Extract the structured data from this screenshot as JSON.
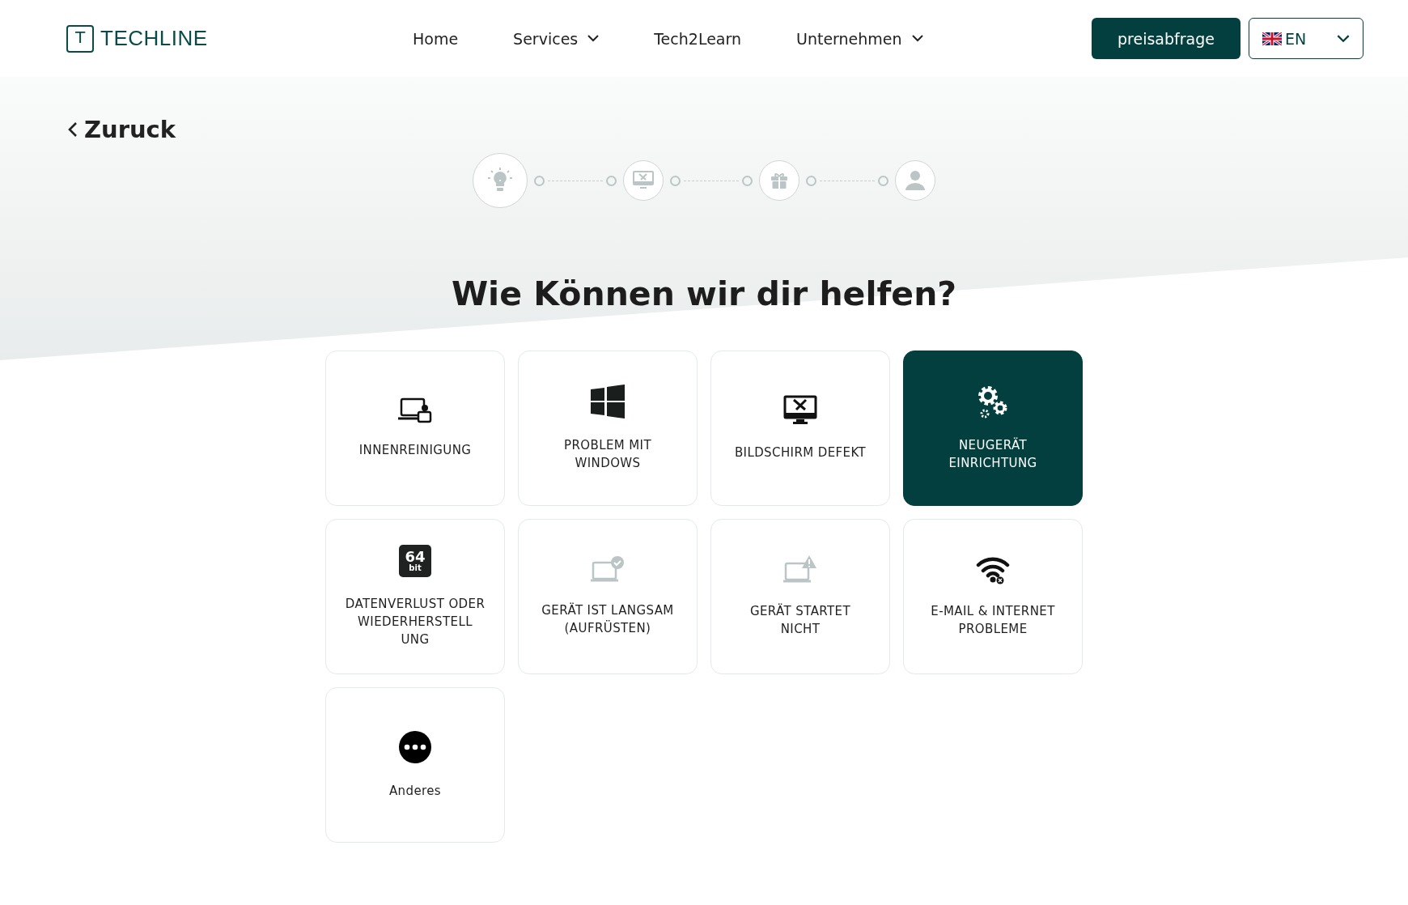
{
  "header": {
    "logo_letter": "T",
    "logo_text": "TECHLINE",
    "nav": [
      {
        "label": "Home",
        "dropdown": false
      },
      {
        "label": "Services",
        "dropdown": true
      },
      {
        "label": "Tech2Learn",
        "dropdown": false
      },
      {
        "label": "Unternehmen",
        "dropdown": true
      }
    ],
    "cta": "preisabfrage",
    "language": "EN"
  },
  "back": "Zuruck",
  "steps": [
    {
      "kind": "idea",
      "selected": true
    },
    {
      "kind": "repair",
      "selected": false
    },
    {
      "kind": "gift",
      "selected": false
    },
    {
      "kind": "user",
      "selected": false
    }
  ],
  "title": "Wie Können wir dir helfen?",
  "cards": [
    {
      "kind": "cleaning",
      "label": "INNENREINIGUNG",
      "selected": false
    },
    {
      "kind": "windows",
      "label": "PROBLEM MIT WINDOWS",
      "selected": false
    },
    {
      "kind": "screen",
      "label": "BILDSCHIRM DEFEKT",
      "selected": false
    },
    {
      "kind": "gears",
      "label": "NEUGERÄT EINRICHTUNG",
      "selected": true
    },
    {
      "kind": "bit",
      "label": "DATENVERLUST ODER WIEDERHERSTELL UNG",
      "badge": "64",
      "badge_sub": "bit",
      "selected": false
    },
    {
      "kind": "laptop-check",
      "label": "GERÄT IST LANGSAM (AUFRÜSTEN)",
      "selected": false
    },
    {
      "kind": "laptop-warning",
      "label": "GERÄT STARTET NICHT",
      "selected": false
    },
    {
      "kind": "wifi",
      "label": "E-MAIL & INTERNET PROBLEME",
      "selected": false
    },
    {
      "kind": "more",
      "label": "Anderes",
      "selected": false
    }
  ]
}
